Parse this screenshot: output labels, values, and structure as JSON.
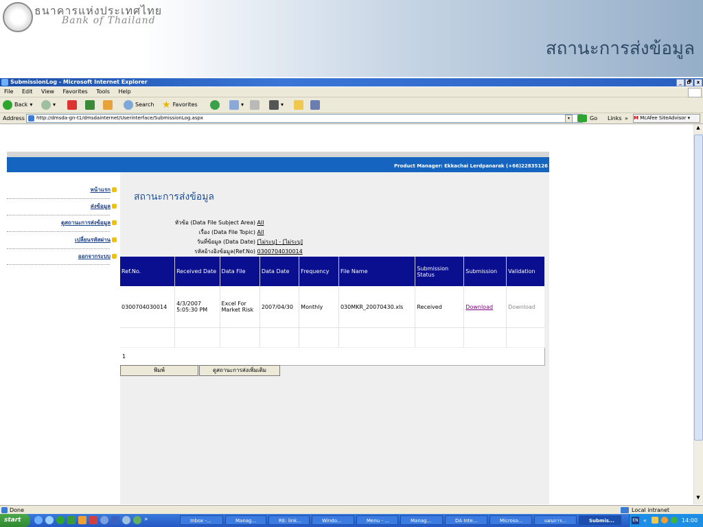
{
  "banner": {
    "bot_thai": "ธนาคารแห่งประเทศไทย",
    "bot_english": "Bank of Thailand",
    "slide_title": "สถานะการส่งข้อมูล"
  },
  "window": {
    "title": "SubmissionLog - Microsoft Internet Explorer",
    "controls": [
      "_",
      "🗗",
      "x"
    ]
  },
  "menu": [
    "File",
    "Edit",
    "View",
    "Favorites",
    "Tools",
    "Help"
  ],
  "toolbar": {
    "back": "Back",
    "search": "Search",
    "favorites": "Favorites"
  },
  "address": {
    "label": "Address",
    "url": "http://dmsda-gn-t1/dmsdainternet/Userinterface/SubmissionLog.aspx",
    "go": "Go",
    "links": "Links",
    "mcafee": "McAfee SiteAdvisor"
  },
  "header": {
    "product_manager": "Product Manager: Ekkachai Lerdpanarak (+66)22835126"
  },
  "sidebar": {
    "items": [
      {
        "label": "หน้าแรก"
      },
      {
        "label": "ส่งข้อมูล"
      },
      {
        "label": "ดูสถานะการส่งข้อมูล"
      },
      {
        "label": "เปลี่ยนรหัสผ่าน"
      },
      {
        "label": "ออกจากระบบ"
      }
    ]
  },
  "main": {
    "page_title": "สถานะการส่งข้อมูล",
    "filters": [
      {
        "label": "หัวข้อ (Data File Subject Area)",
        "value": "All"
      },
      {
        "label": "เรื่อง (Data File Topic)",
        "value": "All"
      },
      {
        "label": "วันที่ข้อมูล (Data Date)",
        "value": "[ไม่ระบุ] - [ไม่ระบุ]"
      },
      {
        "label": "รหัสอ้างอิงข้อมูล(Ref.No)",
        "value": "0300704030014"
      }
    ],
    "table": {
      "headers": [
        "Ref.No.",
        "Received Date",
        "Data File",
        "Data Date",
        "Frequency",
        "File Name",
        "Submission Status",
        "Submission",
        "Validation"
      ],
      "rows": [
        [
          "0300704030014",
          "4/3/2007 5:05:30 PM",
          "Excel For Market Risk",
          "2007/04/30",
          "Monthly",
          "030MKR_20070430.xls",
          "Received",
          "Download",
          "Download"
        ]
      ],
      "pager": "1"
    },
    "buttons": {
      "print": "พิมพ์",
      "more_status": "ดูสถานะการส่งเพิ่มเติม"
    }
  },
  "status": {
    "left": "Done",
    "zone": "Local intranet"
  },
  "taskbar": {
    "start": "start",
    "tasks": [
      "Inbox -...",
      "Manag...",
      "RE: link...",
      "Windo...",
      "Menu - ...",
      "Manag...",
      "DA Inte...",
      "Microso...",
      "แผนการ...",
      "Submis..."
    ],
    "lang": "EN",
    "clock": "14:00"
  },
  "colors": {
    "accent_blue": "#1565c0",
    "table_header": "#0a0f8f",
    "link_purple": "#800080"
  }
}
